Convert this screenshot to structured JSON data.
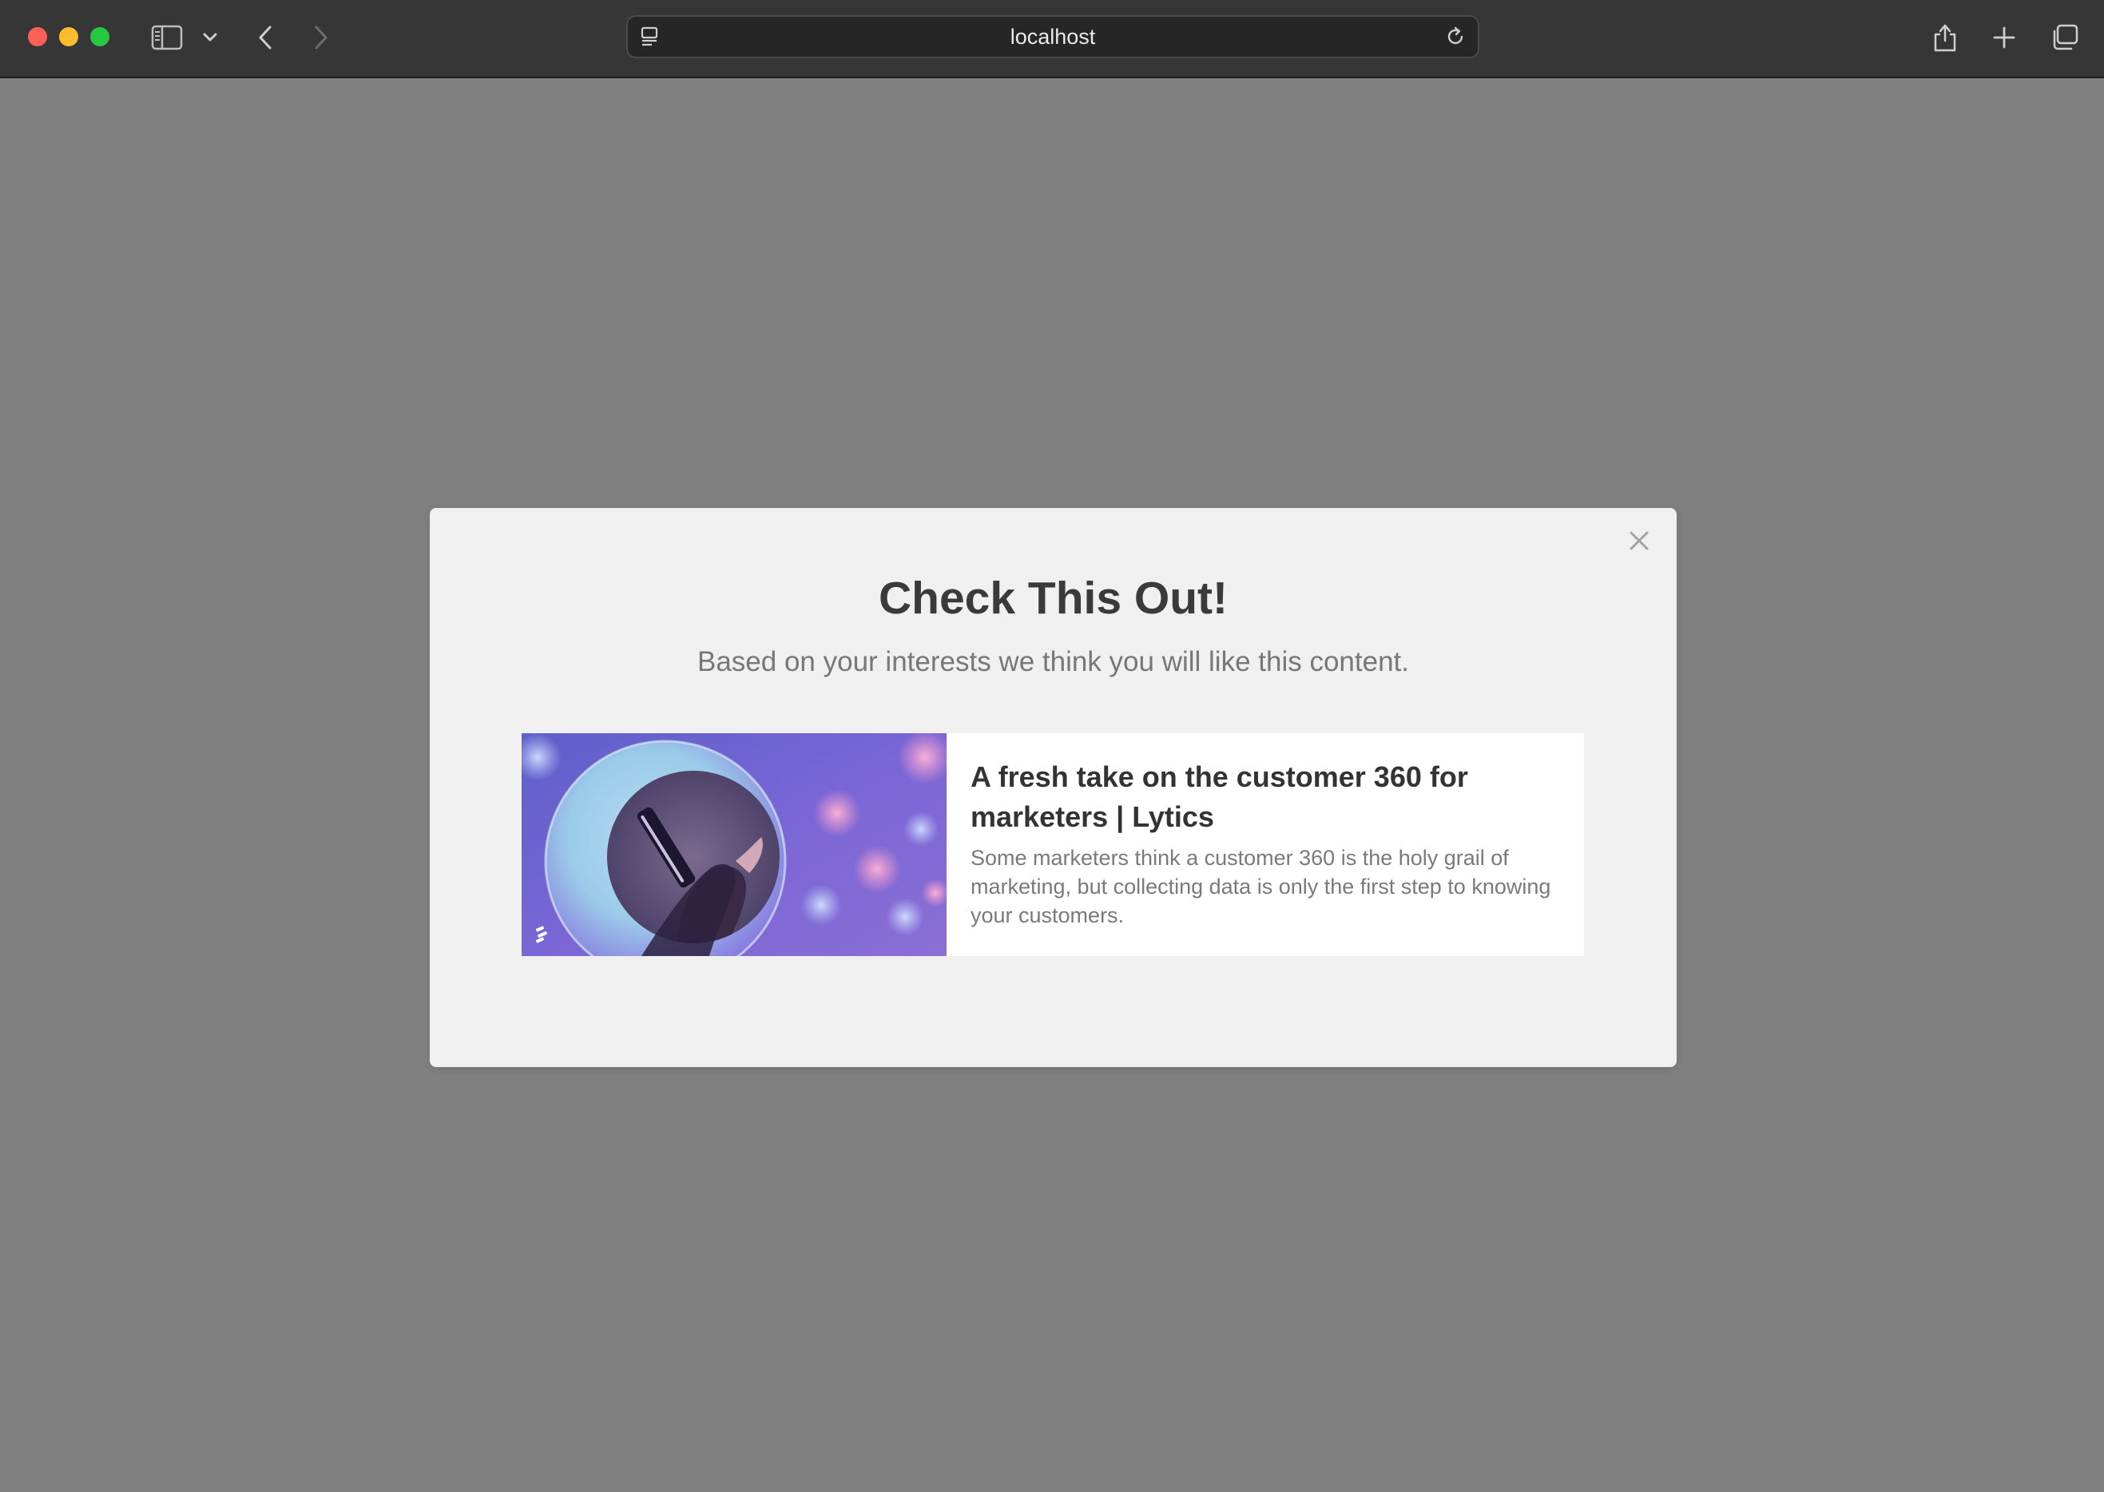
{
  "browser": {
    "url": "localhost",
    "icons": {
      "sidebar": "sidebar-icon",
      "dropdown": "chevron-down-icon",
      "back": "chevron-left-icon",
      "forward": "chevron-right-icon",
      "page": "page-menu-icon",
      "reload": "reload-icon",
      "share": "share-icon",
      "new_tab": "plus-icon",
      "tabs": "tab-overview-icon"
    }
  },
  "modal": {
    "title": "Check This Out!",
    "subtitle": "Based on your interests we think you will like this content.",
    "close_icon": "close-icon",
    "card": {
      "title": "A fresh take on the customer 360 for marketers | Lytics",
      "description": "Some marketers think a customer 360 is the holy grail of marketing, but collecting data is only the first step to knowing your customers."
    }
  },
  "colors": {
    "overlay": "#808080",
    "modal_bg": "#f0f0f0",
    "card_bg": "#ffffff",
    "title": "#3a3a3a",
    "subtitle": "#777777"
  }
}
